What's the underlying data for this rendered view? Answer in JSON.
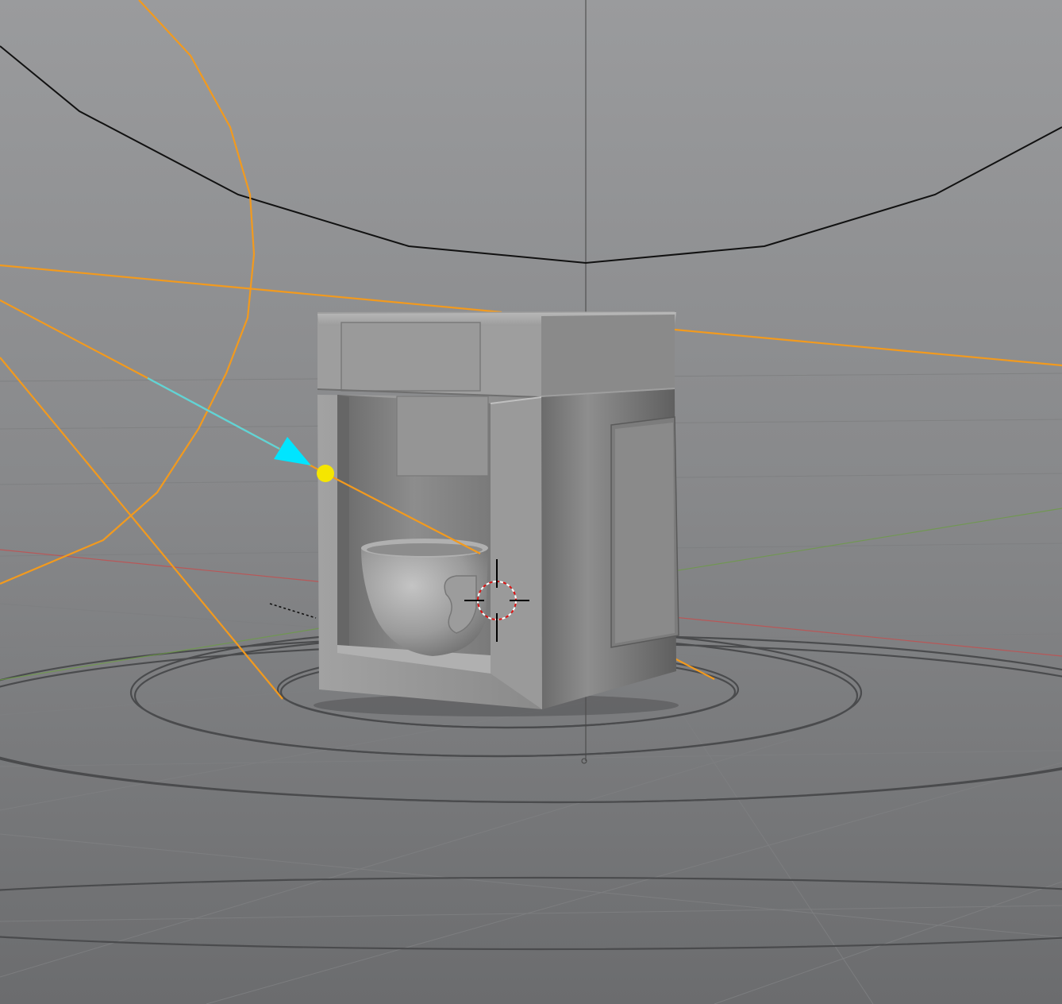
{
  "viewport": {
    "type": "3d-viewport",
    "background_top": "#9a9b9d",
    "background_bottom": "#6b6c6e"
  },
  "colors": {
    "light_gizmo": "#f29a1e",
    "light_direction_arrow": "#00e5ff",
    "light_target_handle": "#f5e600",
    "camera_frustum": "#111111",
    "x_axis": "#c25050",
    "y_axis": "#6e9a4a",
    "z_axis": "#444444",
    "grid_line": "#7e7f81",
    "ground_rings": "#4a4b4d",
    "model_light": "#b3b3b3",
    "model_mid": "#8f8f8f",
    "model_dark": "#5e5e5e"
  },
  "objects": [
    {
      "name": "coffee-machine",
      "kind": "mesh",
      "selected": false
    },
    {
      "name": "cup",
      "kind": "mesh",
      "selected": false
    },
    {
      "name": "spot-light",
      "kind": "light-gizmo",
      "selected": true
    },
    {
      "name": "camera",
      "kind": "camera-gizmo",
      "selected": false
    },
    {
      "name": "3d-cursor",
      "kind": "cursor"
    }
  ],
  "icons": [
    "3d-cursor-icon",
    "light-target-handle-icon",
    "light-direction-arrow-icon"
  ]
}
